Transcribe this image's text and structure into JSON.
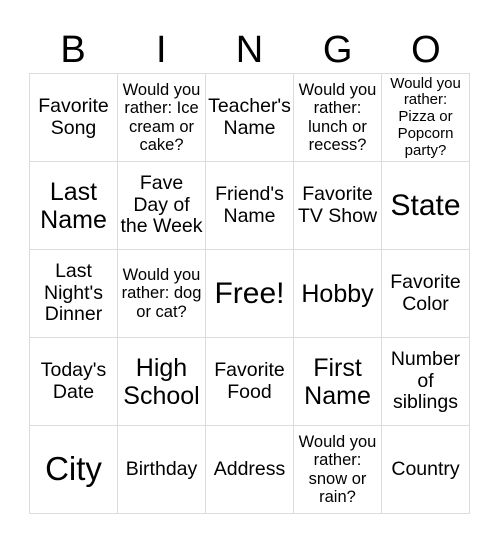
{
  "header": {
    "letters": [
      "B",
      "I",
      "N",
      "G",
      "O"
    ]
  },
  "cells": [
    "Favorite Song",
    "Would you rather: Ice cream or cake?",
    "Teacher's Name",
    "Would you rather: lunch or recess?",
    "Would you rather: Pizza or Popcorn party?",
    "Last Name",
    "Fave Day of the Week",
    "Friend's Name",
    "Favorite TV Show",
    "State",
    "Last Night's Dinner",
    "Would you rather: dog or cat?",
    "Free!",
    "Hobby",
    "Favorite Color",
    "Today's Date",
    "High School",
    "Favorite Food",
    "First Name",
    "Number of siblings",
    "City",
    "Birthday",
    "Address",
    "Would you rather: snow or rain?",
    "Country"
  ]
}
